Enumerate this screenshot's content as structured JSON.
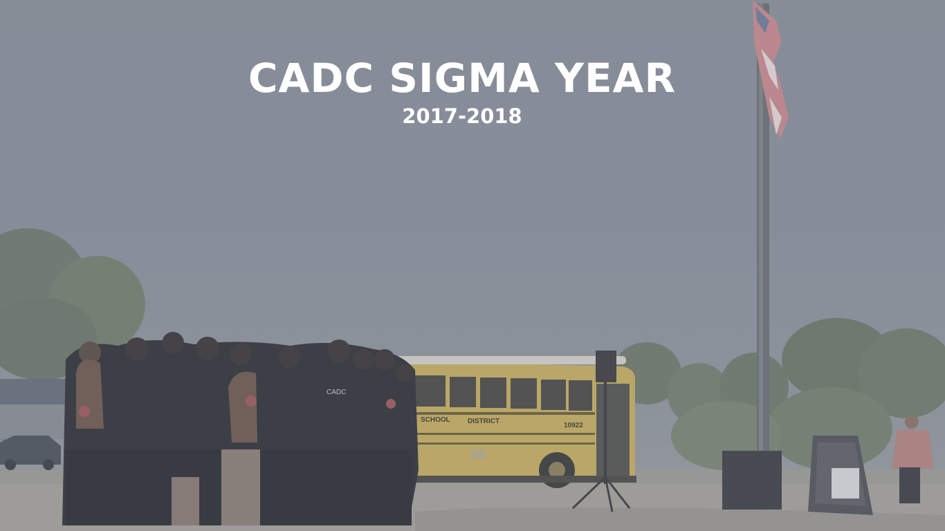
{
  "hero": {
    "title": "CADC SIGMA YEAR",
    "subtitle": "2017-2018"
  },
  "photo": {
    "bus_labels": {
      "left": "SCHOOL",
      "right": "DISTRICT",
      "number": "10922"
    },
    "shirt_text": "CADC"
  },
  "colors": {
    "overlay": "#8a919c",
    "title_text": "#ffffff",
    "bus_yellow": "#c9b060"
  }
}
